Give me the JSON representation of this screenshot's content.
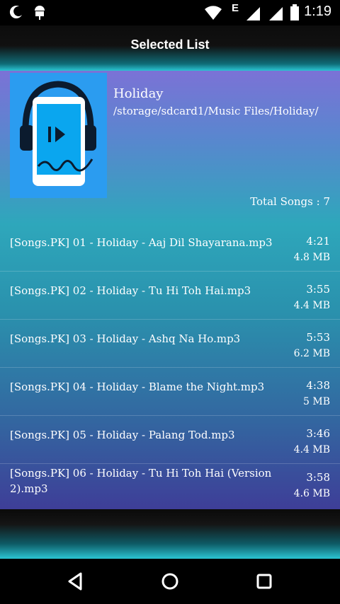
{
  "status": {
    "time": "1:19",
    "network_label": "E",
    "icons": [
      "moon-icon",
      "android-debug-icon",
      "wifi-icon",
      "signal-icon",
      "battery-icon"
    ]
  },
  "header": {
    "title": "Selected List"
  },
  "album": {
    "name": "Holiday",
    "path": "/storage/sdcard1/Music Files/Holiday/",
    "total_songs": "Total Songs : 7"
  },
  "songs": [
    {
      "name": "[Songs.PK] 01 - Holiday - Aaj Dil Shayarana.mp3",
      "duration": "4:21",
      "size": "4.8 MB"
    },
    {
      "name": "[Songs.PK] 02 - Holiday - Tu Hi Toh Hai.mp3",
      "duration": "3:55",
      "size": "4.4 MB"
    },
    {
      "name": "[Songs.PK] 03 - Holiday - Ashq Na Ho.mp3",
      "duration": "5:53",
      "size": "6.2 MB"
    },
    {
      "name": "[Songs.PK] 04 - Holiday - Blame the Night.mp3",
      "duration": "4:38",
      "size": "5 MB"
    },
    {
      "name": "[Songs.PK] 05 - Holiday - Palang Tod.mp3",
      "duration": "3:46",
      "size": "4.4 MB"
    },
    {
      "name": "[Songs.PK] 06 - Holiday - Tu Hi Toh Hai (Version 2).mp3",
      "duration": "3:58",
      "size": "4.6 MB"
    }
  ],
  "navigation": {
    "buttons": [
      "back-icon",
      "home-icon",
      "recents-icon"
    ]
  },
  "colors": {
    "accent": "#2bc4d2",
    "art_blue": "#2b9cf0"
  }
}
